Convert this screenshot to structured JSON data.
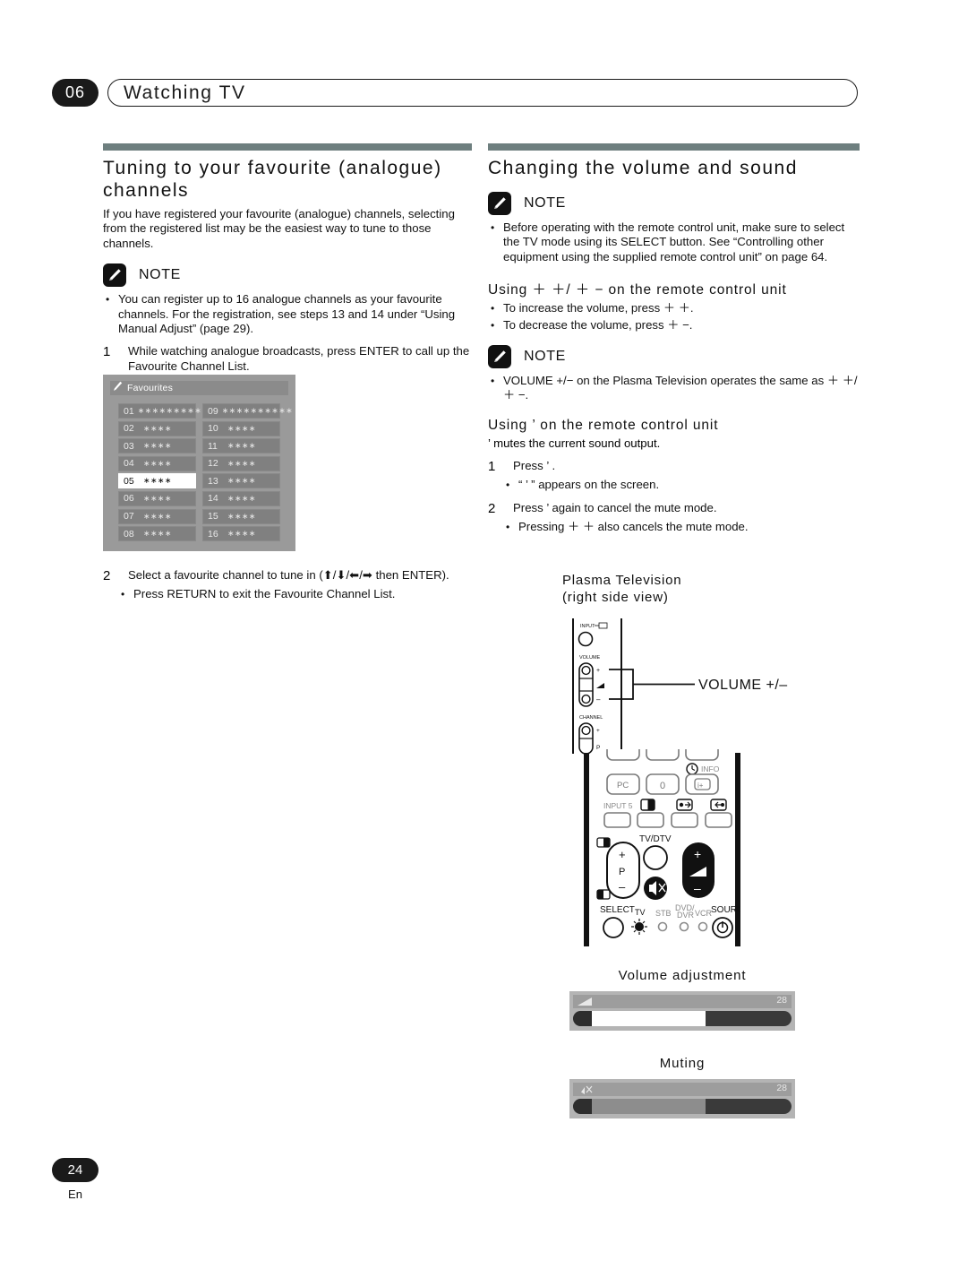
{
  "header": {
    "chapter_number": "06",
    "chapter_title": "Watching TV"
  },
  "left_column": {
    "section_title": "Tuning to your favourite (analogue) channels",
    "intro": "If you have registered your favourite (analogue) channels, selecting from the registered list may be the easiest way to tune to those channels.",
    "note_label": "NOTE",
    "note_bullets": [
      "You can register up to 16 analogue channels as your favourite channels. For the registration, see steps 13 and 14 under “Using Manual Adjust” (page 29)."
    ],
    "steps": [
      {
        "num": "1",
        "text": "While watching analogue broadcasts, press ENTER to call up the Favourite Channel List.",
        "bullets": []
      },
      {
        "num": "2",
        "text": "Select a favourite channel to tune in (⬆/⬇/⬅/➡ then ENTER).",
        "bullets": [
          "Press RETURN to exit the Favourite Channel List."
        ]
      }
    ]
  },
  "favourites_osd": {
    "title": "Favourites",
    "selected_index": 4,
    "rows": [
      {
        "number": "01",
        "stars": "∗∗∗∗∗∗∗∗∗∗"
      },
      {
        "number": "02",
        "stars": "∗∗∗∗"
      },
      {
        "number": "03",
        "stars": "∗∗∗∗"
      },
      {
        "number": "04",
        "stars": "∗∗∗∗"
      },
      {
        "number": "05",
        "stars": "∗∗∗∗"
      },
      {
        "number": "06",
        "stars": "∗∗∗∗"
      },
      {
        "number": "07",
        "stars": "∗∗∗∗"
      },
      {
        "number": "08",
        "stars": "∗∗∗∗"
      },
      {
        "number": "09",
        "stars": "∗∗∗∗∗∗∗∗∗∗"
      },
      {
        "number": "10",
        "stars": "∗∗∗∗"
      },
      {
        "number": "11",
        "stars": "∗∗∗∗"
      },
      {
        "number": "12",
        "stars": "∗∗∗∗"
      },
      {
        "number": "13",
        "stars": "∗∗∗∗"
      },
      {
        "number": "14",
        "stars": "∗∗∗∗"
      },
      {
        "number": "15",
        "stars": "∗∗∗∗"
      },
      {
        "number": "16",
        "stars": "∗∗∗∗"
      }
    ]
  },
  "right_column": {
    "section_title": "Changing the volume and sound",
    "note1_label": "NOTE",
    "note1_bullets": [
      "Before operating with the remote control unit, make sure to select the TV mode using its SELECT button. See “Controlling other equipment using the supplied remote control unit” on page 64."
    ],
    "sub1_title": "Using  ＋  ＋/ ＋   − on the remote control unit",
    "sub1_bullets": [
      "To increase the volume, press  ＋   ＋.",
      "To decrease the volume, press  ＋   −."
    ],
    "note2_label": "NOTE",
    "note2_bullets": [
      "VOLUME +/− on the Plasma Television operates the same as  ＋   ＋/ ＋   −."
    ],
    "sub2_title": "Using  ’  on the remote control unit",
    "sub2_intro": "’  mutes the current sound output.",
    "steps": [
      {
        "num": "1",
        "text": "Press ’ .",
        "bullets": [
          "“ ’ ” appears on the screen."
        ]
      },
      {
        "num": "2",
        "text": "Press ’  again to cancel the mute mode.",
        "bullets": [
          "Pressing ＋   ＋ also cancels the mute mode."
        ]
      }
    ]
  },
  "tv_diagram": {
    "caption_line1": "Plasma Television",
    "caption_line2": "(right side view)",
    "label_input": "INPUT",
    "label_volume": "VOLUME",
    "label_channel": "CHANNEL",
    "callout": "VOLUME +/−",
    "vol_plus": "+",
    "vol_minus": "−",
    "ch_plus": "+",
    "ch_p": "P"
  },
  "remote": {
    "btn_pc": "PC",
    "btn_zero": "0",
    "label_info": "INFO",
    "btn_info": "i+",
    "label_input5": "INPUT 5",
    "label_tvdtv": "TV/DTV",
    "ch_plus": "+",
    "ch_p": "P",
    "ch_minus": "−",
    "vol_plus": "+",
    "vol_minus": "−",
    "label_select": "SELECT",
    "label_tv": "TV",
    "label_stb": "STB",
    "label_dvd1": "DVD/",
    "label_dvd2": "DVR",
    "label_vcr": "VCR",
    "label_source": "SOURCE"
  },
  "osd_bars": {
    "volume": {
      "caption": "Volume adjustment",
      "value": "28",
      "fill_percent": 52,
      "fill_color": "#ffffff"
    },
    "muting": {
      "caption": "Muting",
      "value": "28",
      "fill_percent": 52,
      "fill_color": "#8d8d8d"
    }
  },
  "footer": {
    "page_number": "24",
    "language": "En"
  },
  "colors": {
    "accent_bar": "#6e7f7f",
    "badge": "#1a1a1a",
    "osd_bg": "#9a9a9a"
  }
}
